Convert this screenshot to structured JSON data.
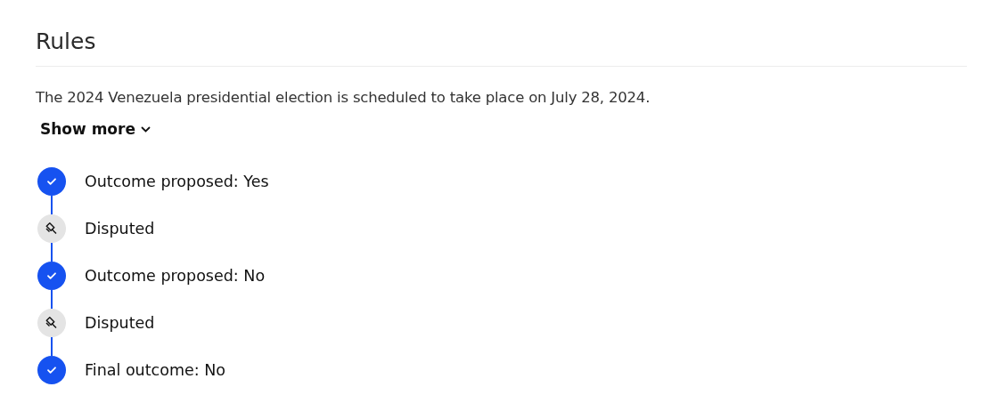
{
  "section": {
    "title": "Rules"
  },
  "description": "The 2024 Venezuela presidential election is scheduled to take place on July 28, 2024.",
  "show_more": {
    "label": "Show more",
    "expanded": false
  },
  "timeline": [
    {
      "kind": "resolved",
      "label": "Outcome proposed: Yes"
    },
    {
      "kind": "disputed",
      "label": "Disputed"
    },
    {
      "kind": "resolved",
      "label": "Outcome proposed: No"
    },
    {
      "kind": "disputed",
      "label": "Disputed"
    },
    {
      "kind": "resolved",
      "label": "Final outcome: No"
    }
  ]
}
